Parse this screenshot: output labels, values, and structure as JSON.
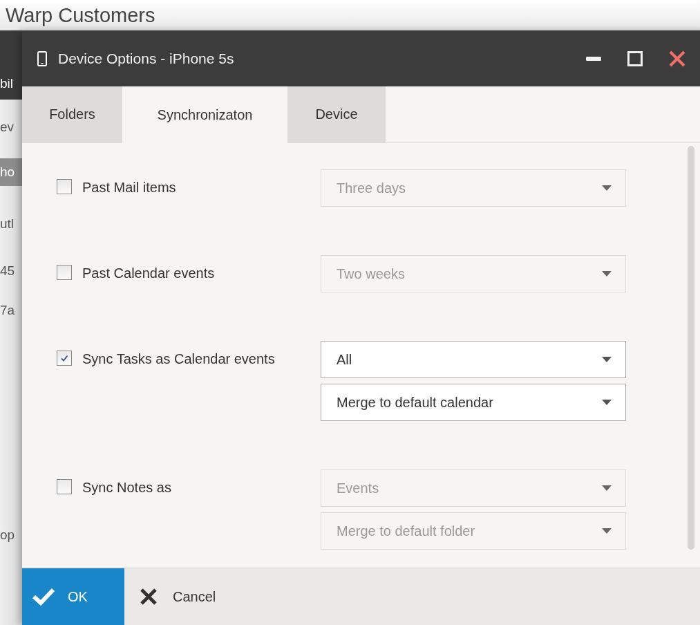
{
  "background": {
    "heading": "Warp Customers",
    "fragments": [
      {
        "text": "bil",
        "kind": "dark"
      },
      {
        "text": "ev",
        "kind": "plain"
      },
      {
        "text": "ho",
        "kind": "bar"
      },
      {
        "text": "utl",
        "kind": "plain"
      },
      {
        "text": "45",
        "kind": "plain"
      },
      {
        "text": "7a",
        "kind": "plain"
      },
      {
        "text": "op",
        "kind": "plain"
      }
    ]
  },
  "window": {
    "title": "Device Options - iPhone 5s"
  },
  "tabs": [
    {
      "label": "Folders",
      "selected": false
    },
    {
      "label": "Synchronizaton",
      "selected": true
    },
    {
      "label": "Device",
      "selected": false
    }
  ],
  "options": [
    {
      "label": "Past Mail items",
      "checked": false,
      "selects": [
        {
          "value": "Three days",
          "disabled": true
        }
      ]
    },
    {
      "label": "Past Calendar events",
      "checked": false,
      "selects": [
        {
          "value": "Two weeks",
          "disabled": true
        }
      ]
    },
    {
      "label": "Sync Tasks as Calendar events",
      "checked": true,
      "selects": [
        {
          "value": "All",
          "disabled": false
        },
        {
          "value": "Merge to default calendar",
          "disabled": false
        }
      ]
    },
    {
      "label": "Sync Notes as",
      "checked": false,
      "selects": [
        {
          "value": "Events",
          "disabled": true
        },
        {
          "value": "Merge to default folder",
          "disabled": true
        }
      ]
    }
  ],
  "buttons": [
    {
      "label": "OK",
      "kind": "primary"
    },
    {
      "label": "Cancel",
      "kind": "cancel"
    }
  ]
}
